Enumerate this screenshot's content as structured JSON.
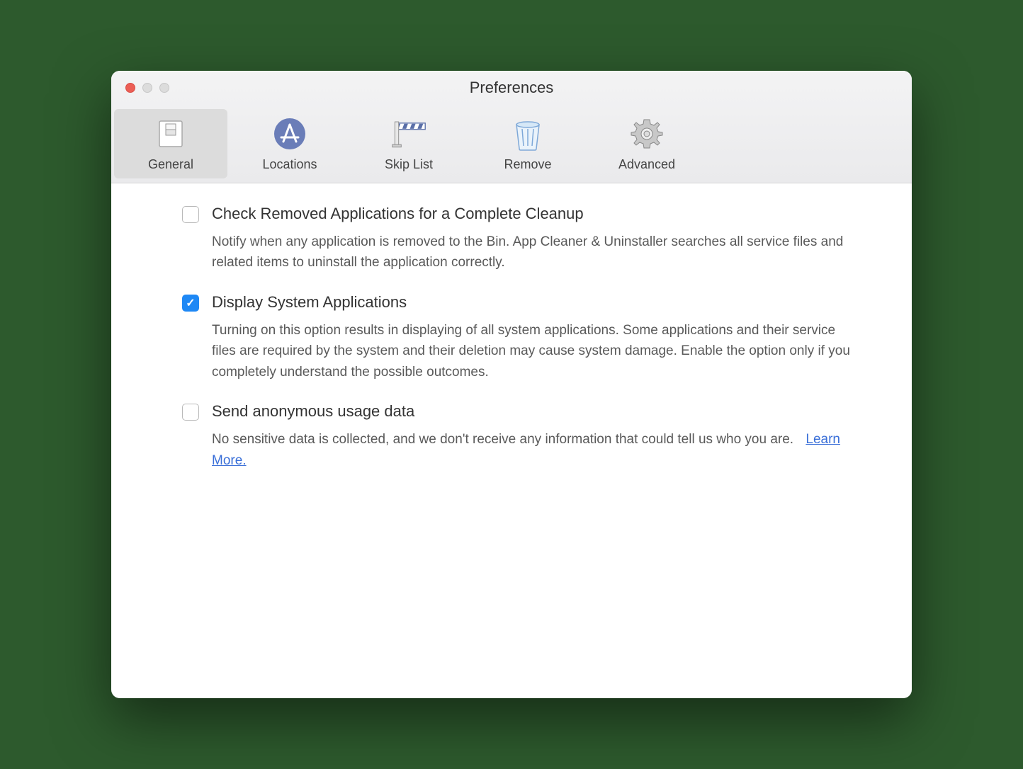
{
  "window": {
    "title": "Preferences"
  },
  "toolbar": {
    "items": [
      {
        "label": "General",
        "icon": "switch-icon",
        "active": true
      },
      {
        "label": "Locations",
        "icon": "app-store-icon",
        "active": false
      },
      {
        "label": "Skip List",
        "icon": "barrier-icon",
        "active": false
      },
      {
        "label": "Remove",
        "icon": "trash-icon",
        "active": false
      },
      {
        "label": "Advanced",
        "icon": "gear-icon",
        "active": false
      }
    ]
  },
  "settings": [
    {
      "checked": false,
      "title": "Check Removed Applications for a Complete Cleanup",
      "desc": "Notify when any application is removed to the Bin. App Cleaner & Uninstaller searches all service files and related items to uninstall the application correctly."
    },
    {
      "checked": true,
      "title": "Display System Applications",
      "desc": "Turning on this option results in displaying of all system applications. Some applications and their service files are required by the system and their deletion may cause system damage. Enable the option only if you completely understand the possible outcomes."
    },
    {
      "checked": false,
      "title": "Send anonymous usage data",
      "desc": "No sensitive data is collected, and we don't receive any information that could tell us who you are.",
      "link_label": "Learn More."
    }
  ]
}
